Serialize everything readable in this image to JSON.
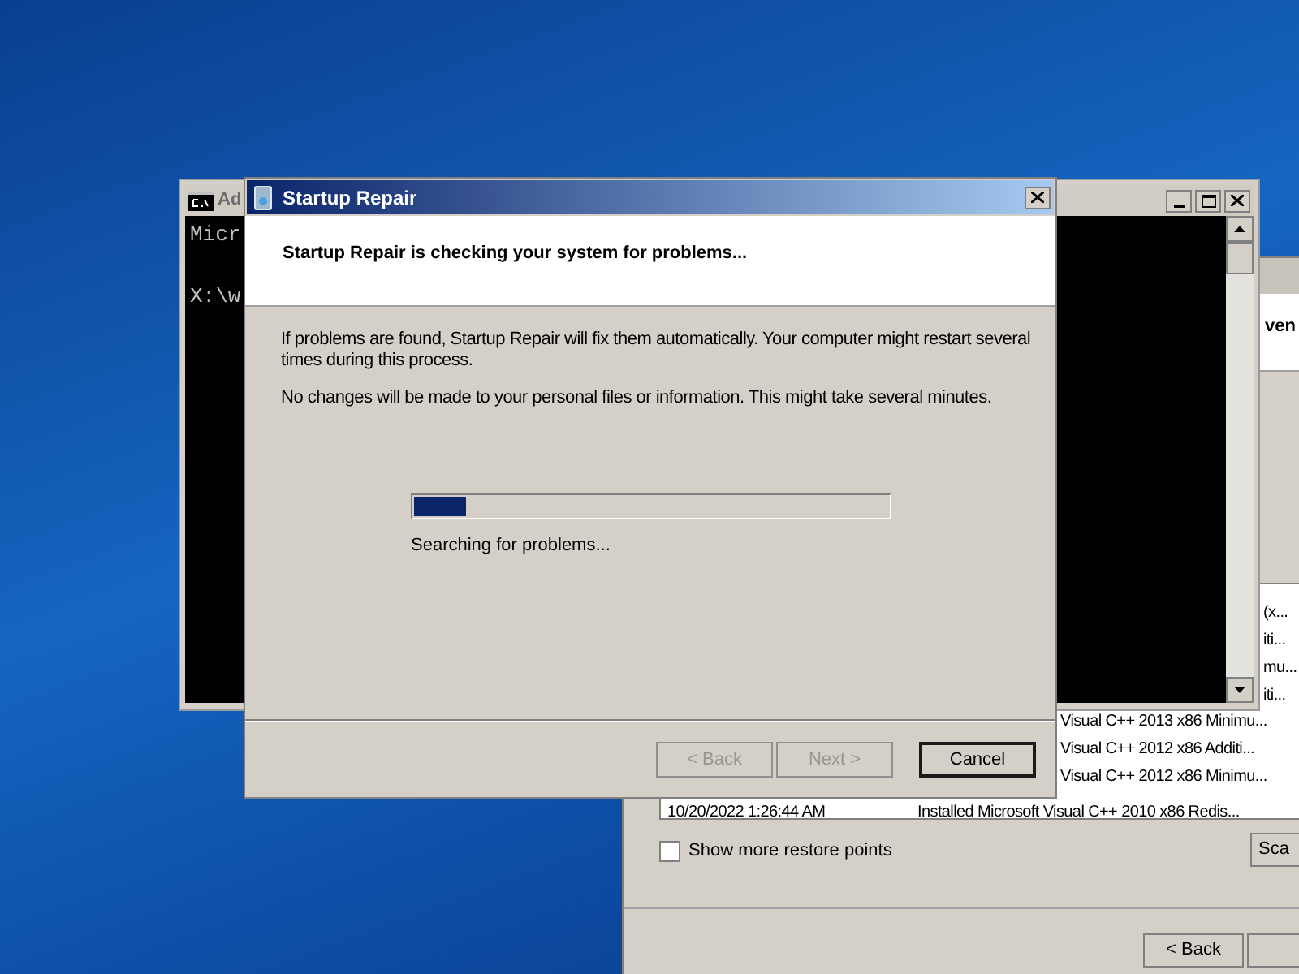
{
  "restore_window": {
    "header_text": "ven",
    "row_fragments": [
      "(x...",
      "iti...",
      "mu...",
      "iti..."
    ],
    "rows": [
      {
        "description": "Visual C++ 2013 x86 Minimu..."
      },
      {
        "description": "Visual C++ 2012 x86 Additi..."
      },
      {
        "description": "Visual C++ 2012 x86 Minimu..."
      },
      {
        "date": "10/20/2022 1:26:44 AM",
        "description": "Installed Microsoft Visual C++ 2010  x86 Redis..."
      }
    ],
    "show_more": {
      "label": "Show more restore points",
      "checked": false
    },
    "scan_button": "Sca",
    "back_button": "< Back"
  },
  "console_window": {
    "title": "Ad",
    "lines": [
      "Micr",
      "X:\\w"
    ]
  },
  "dialog": {
    "title": "Startup Repair",
    "heading": "Startup Repair is checking your system for problems...",
    "paragraphs": [
      "If problems are found, Startup Repair will fix them automatically. Your computer might restart several times during this process.",
      "No changes will be made to your personal files or information. This might take several minutes."
    ],
    "progress": {
      "level": 0.11,
      "status": "Searching for problems..."
    },
    "buttons": [
      {
        "label": "< Back",
        "disabled": true,
        "default": false
      },
      {
        "label": "Next >",
        "disabled": true,
        "default": false
      },
      {
        "label": "Cancel",
        "disabled": false,
        "default": true
      }
    ]
  }
}
